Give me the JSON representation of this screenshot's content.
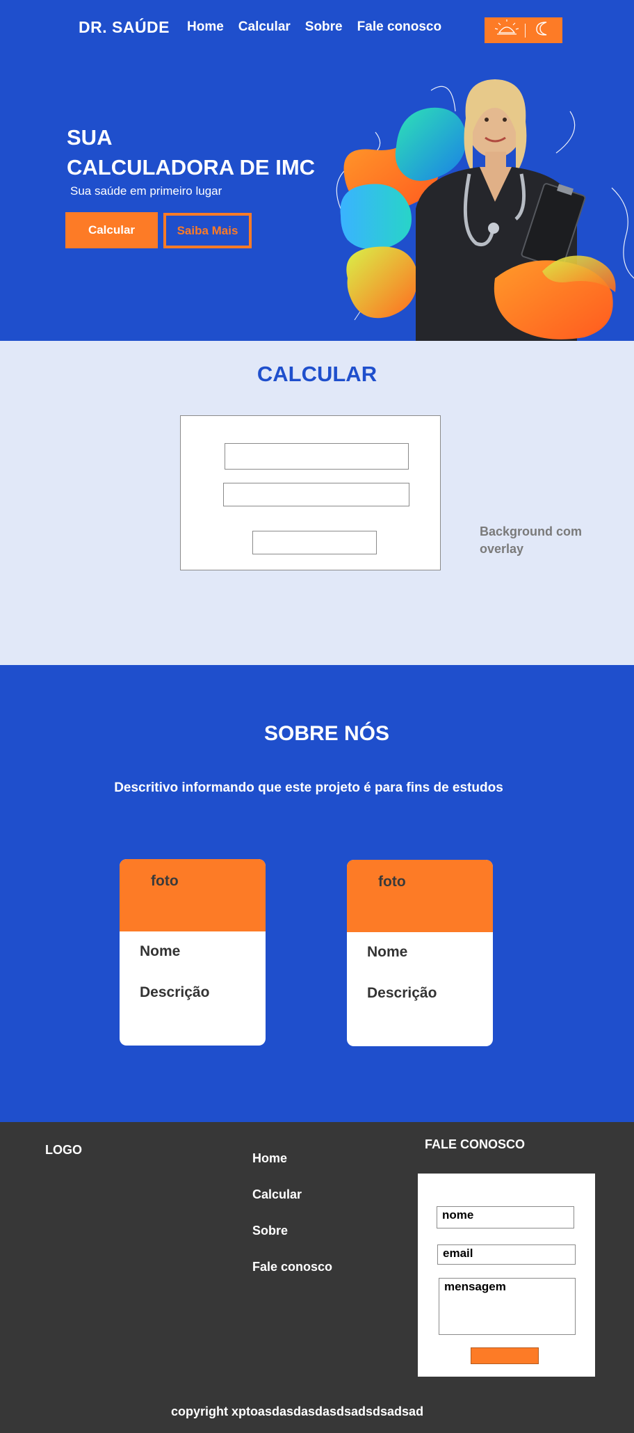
{
  "brand": {
    "logo_text": "DR. SAÚDE",
    "primary_color": "#1f4fcc",
    "accent_color": "#fd7b26",
    "footer_color": "#373737",
    "calc_bg_color": "#e1e8f8"
  },
  "nav": {
    "items": [
      "Home",
      "Calcular",
      "Sobre",
      "Fale conosco"
    ]
  },
  "theme_toggle": {
    "left_icon": "sun-icon",
    "right_icon": "moon-icon"
  },
  "hero": {
    "title_line1": "SUA",
    "title_line2": "CALCULADORA DE IMC",
    "subtitle": "Sua saúde em primeiro lugar",
    "primary_button": "Calcular",
    "secondary_button": "Saiba Mais"
  },
  "calculator": {
    "title": "CALCULAR",
    "note": "Background com overlay"
  },
  "about": {
    "title": "SOBRE NÓS",
    "description": "Descritivo informando que este projeto é para fins de estudos",
    "cards": [
      {
        "photo_label": "foto",
        "name": "Nome",
        "description": "Descrição"
      },
      {
        "photo_label": "foto",
        "name": "Nome",
        "description": "Descrição"
      }
    ]
  },
  "footer": {
    "logo_text": "LOGO",
    "links": [
      "Home",
      "Calcular",
      "Sobre",
      "Fale conosco"
    ],
    "contact_title": "FALE CONOSCO",
    "contact_form": {
      "name_placeholder": "nome",
      "email_placeholder": "email",
      "message_placeholder": "mensagem"
    },
    "copyright": "copyright xptoasdasdasdasdsadsdsadsad"
  }
}
